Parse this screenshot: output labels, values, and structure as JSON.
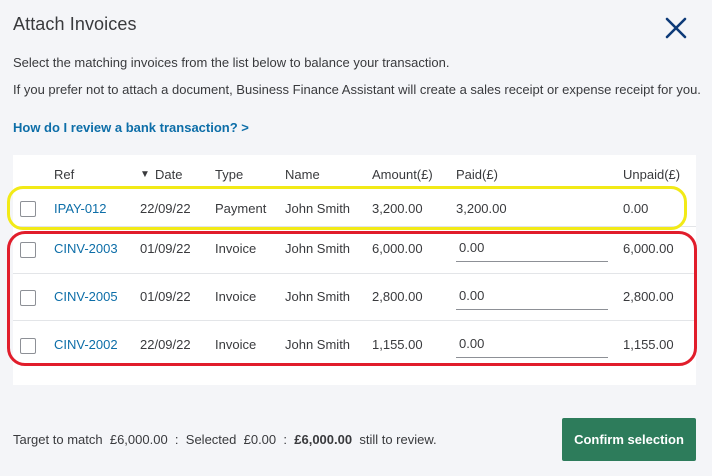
{
  "dialog": {
    "title": "Attach Invoices",
    "intro_line1": "Select the matching invoices from the list below to balance your transaction.",
    "intro_line2": "If you prefer not to attach a document, Business Finance Assistant will create a sales receipt or expense receipt for you.",
    "help_link": "How do I review a bank transaction? >"
  },
  "table": {
    "headers": {
      "ref": "Ref",
      "date": "Date",
      "type": "Type",
      "name": "Name",
      "amount": "Amount(£)",
      "paid": "Paid(£)",
      "unpaid": "Unpaid(£)"
    },
    "sort_indicator": "▼",
    "rows": [
      {
        "ref": "IPAY-012",
        "date": "22/09/22",
        "type": "Payment",
        "name": "John Smith",
        "amount": "3,200.00",
        "paid": "3,200.00",
        "unpaid": "0.00",
        "highlight": "yellow"
      },
      {
        "ref": "CINV-2003",
        "date": "01/09/22",
        "type": "Invoice",
        "name": "John Smith",
        "amount": "6,000.00",
        "paid": "0.00",
        "unpaid": "6,000.00",
        "highlight": "red"
      },
      {
        "ref": "CINV-2005",
        "date": "01/09/22",
        "type": "Invoice",
        "name": "John Smith",
        "amount": "2,800.00",
        "paid": "0.00",
        "unpaid": "2,800.00",
        "highlight": "red"
      },
      {
        "ref": "CINV-2002",
        "date": "22/09/22",
        "type": "Invoice",
        "name": "John Smith",
        "amount": "1,155.00",
        "paid": "0.00",
        "unpaid": "1,155.00",
        "highlight": "red"
      }
    ]
  },
  "footer": {
    "target_label": "Target to match",
    "target_value": "£6,000.00",
    "separator": ":",
    "selected_label": "Selected",
    "selected_value": "£0.00",
    "remaining_value": "£6,000.00",
    "remaining_label": "still to review.",
    "confirm_label": "Confirm selection"
  },
  "colors": {
    "link": "#0d6ea8",
    "confirm_button": "#2d7c5b",
    "close_icon": "#0d3a78",
    "highlight_yellow": "#f2ea17",
    "highlight_red": "#e11d2b"
  },
  "icons": {
    "close": "close-icon",
    "sort": "sort-down-icon"
  }
}
